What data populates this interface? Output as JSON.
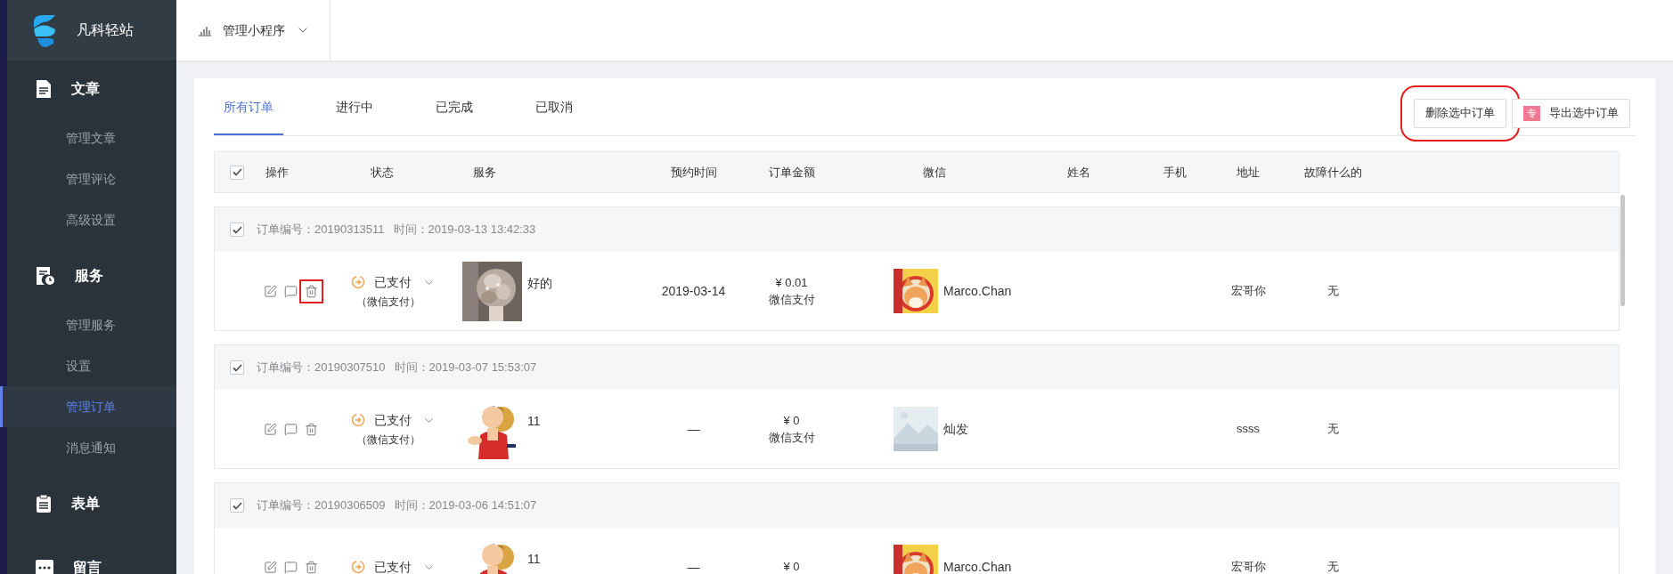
{
  "brand": {
    "name": "凡科轻站"
  },
  "header": {
    "app_switcher": "管理小程序"
  },
  "sidebar": {
    "sections": [
      {
        "kind": "article",
        "label": "文章",
        "items": [
          {
            "label": "管理文章",
            "selected": false
          },
          {
            "label": "管理评论",
            "selected": false
          },
          {
            "label": "高级设置",
            "selected": false
          }
        ]
      },
      {
        "kind": "service",
        "label": "服务",
        "items": [
          {
            "label": "管理服务",
            "selected": false
          },
          {
            "label": "设置",
            "selected": false
          },
          {
            "label": "管理订单",
            "selected": true
          },
          {
            "label": "消息通知",
            "selected": false
          }
        ]
      },
      {
        "kind": "form",
        "label": "表单"
      },
      {
        "kind": "message",
        "label": "留言"
      }
    ]
  },
  "tabs": [
    {
      "label": "所有订单",
      "selected": true
    },
    {
      "label": "进行中",
      "selected": false
    },
    {
      "label": "已完成",
      "selected": false
    },
    {
      "label": "已取消",
      "selected": false
    }
  ],
  "actions": [
    {
      "kind": "delete",
      "label": "删除选中订单",
      "highlighted": true
    },
    {
      "kind": "export",
      "label": "导出选中订单",
      "badge": "专",
      "highlighted": false
    }
  ],
  "table": {
    "select_all": {
      "checked": true
    },
    "columns": [
      "操作",
      "状态",
      "服务",
      "预约时间",
      "订单金额",
      "微信",
      "姓名",
      "手机",
      "地址",
      "故障什么的"
    ],
    "orders": [
      {
        "checked": true,
        "order_no": "订单编号：20190313511",
        "time": "时间：2019-03-13 13:42:33",
        "ops": [
          {
            "kind": "edit",
            "highlighted": false
          },
          {
            "kind": "comment",
            "highlighted": false
          },
          {
            "kind": "delete",
            "highlighted": true
          }
        ],
        "status": "已支付",
        "status_note": "（微信支付）",
        "service": "好的",
        "date": "2019-03-14",
        "amount": "¥ 0.01",
        "payment": "微信支付",
        "wechat": "Marco.Chan",
        "address": "宏哥你",
        "fault": "无"
      },
      {
        "checked": true,
        "order_no": "订单编号：20190307510",
        "time": "时间：2019-03-07 15:53:07",
        "ops": [
          {
            "kind": "edit",
            "highlighted": false
          },
          {
            "kind": "comment",
            "highlighted": false
          },
          {
            "kind": "delete",
            "highlighted": false
          }
        ],
        "status": "已支付",
        "status_note": "（微信支付）",
        "service": "11",
        "date": "—",
        "amount": "¥ 0",
        "payment": "微信支付",
        "wechat": "灿发",
        "address": "ssss",
        "fault": "无"
      },
      {
        "checked": true,
        "order_no": "订单编号：20190306509",
        "time": "时间：2019-03-06 14:51:07",
        "ops": [
          {
            "kind": "edit",
            "highlighted": false
          },
          {
            "kind": "comment",
            "highlighted": false
          },
          {
            "kind": "delete",
            "highlighted": false
          }
        ],
        "status": "已支付",
        "service": "11",
        "date": "—",
        "amount": "¥ 0",
        "wechat": "Marco.Chan",
        "address": "宏哥你",
        "fault": "无"
      }
    ]
  }
}
